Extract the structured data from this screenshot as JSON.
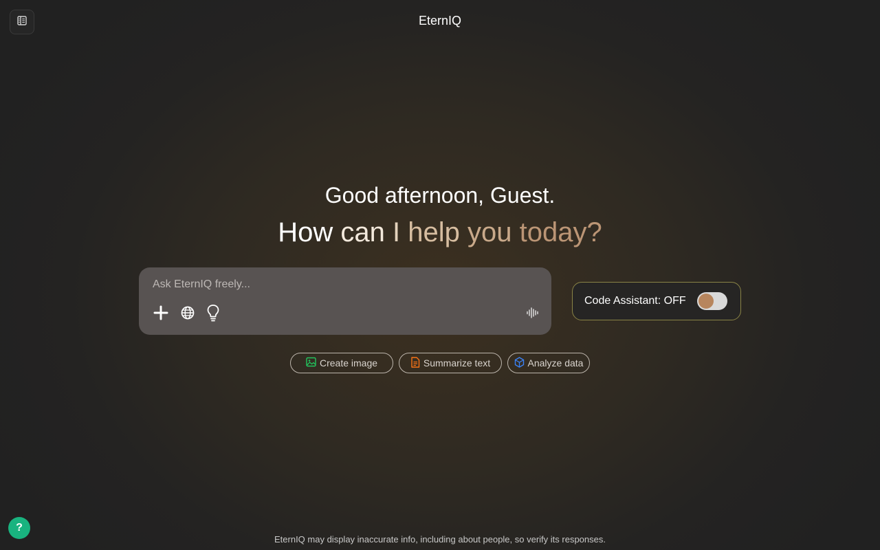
{
  "header": {
    "app_title": "EternIQ",
    "sidebar_toggle_icon": "sidebar-icon"
  },
  "hero": {
    "greeting": "Good afternoon, Guest.",
    "question_words": [
      "How",
      "can",
      "I",
      "help",
      "you",
      "today?"
    ]
  },
  "prompt": {
    "placeholder": "Ask EternIQ freely...",
    "value": "",
    "tools": [
      "plus-icon",
      "globe-icon",
      "lightbulb-icon"
    ],
    "voice_icon": "audio-waveform-icon"
  },
  "code_assistant": {
    "label": "Code Assistant: OFF",
    "enabled": false,
    "knob_color": "#b7855d"
  },
  "suggestions": [
    {
      "label": "Create image",
      "icon": "image-icon",
      "color": "#22c55e"
    },
    {
      "label": "Summarize text",
      "icon": "document-icon",
      "color": "#f97316"
    },
    {
      "label": "Analyze data",
      "icon": "cube-icon",
      "color": "#3b82f6"
    }
  ],
  "help": {
    "label": "?",
    "color": "#19b37f"
  },
  "footer": {
    "disclaimer": "EternIQ may display inaccurate info, including about people, so verify its responses."
  }
}
